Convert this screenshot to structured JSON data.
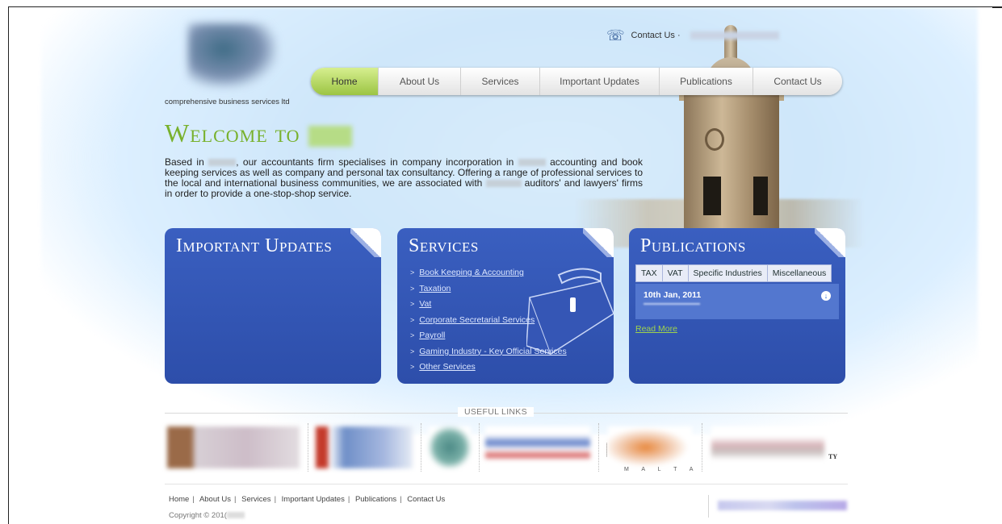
{
  "header": {
    "tagline": "comprehensive business services ltd",
    "contact_label": "Contact Us ·"
  },
  "nav": {
    "items": [
      {
        "label": "Home",
        "active": true
      },
      {
        "label": "About Us"
      },
      {
        "label": "Services"
      },
      {
        "label": "Important Updates"
      },
      {
        "label": "Publications"
      },
      {
        "label": "Contact Us"
      }
    ]
  },
  "welcome": {
    "title": "Welcome to",
    "intro_1": "Based in",
    "intro_2": ", our accountants firm specialises in company incorporation in",
    "intro_3": "accounting and book keeping services as well as company and personal tax consultancy. Offering a range of professional services to the local and international business communities, we are associated with",
    "intro_4": "auditors' and lawyers' firms in order to provide a one-stop-shop service."
  },
  "panels": {
    "updates_title": "Important Updates",
    "services_title": "Services",
    "services": [
      "Book Keeping & Accounting",
      "Taxation",
      "Vat",
      "Corporate Secretarial Services",
      "Payroll",
      "Gaming Industry - Key Official Services",
      "Other Services"
    ],
    "publications_title": "Publications",
    "pub_tabs": [
      "TAX",
      "VAT",
      "Specific Industries",
      "Miscellaneous"
    ],
    "pub_date": "10th Jan, 2011",
    "read_more": "Read More"
  },
  "useful_links": {
    "title": "USEFUL LINKS",
    "malta_text": "M A L T A",
    "tv_text": "TY"
  },
  "footer": {
    "links": [
      "Home",
      "About Us",
      "Services",
      "Important Updates",
      "Publications",
      "Contact Us"
    ],
    "copyright": "Copyright © 201("
  }
}
